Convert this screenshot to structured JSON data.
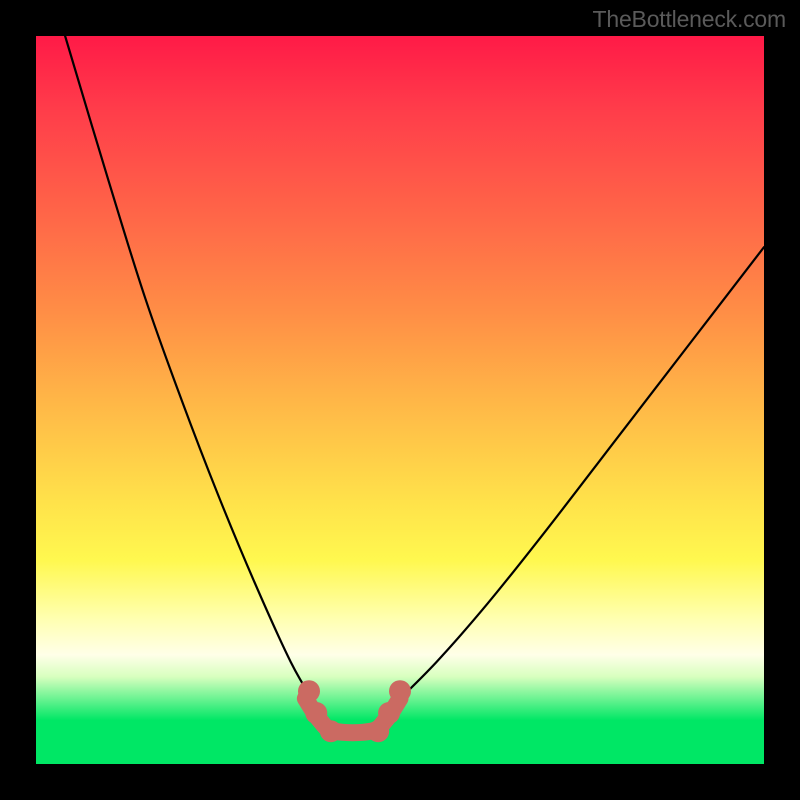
{
  "watermark": "TheBottleneck.com",
  "chart_data": {
    "type": "line",
    "title": "",
    "xlabel": "",
    "ylabel": "",
    "xlim": [
      0,
      100
    ],
    "ylim": [
      0,
      100
    ],
    "background_gradient": {
      "direction": "top_to_bottom",
      "stops": [
        {
          "pos": 0,
          "color": "#ff1a47"
        },
        {
          "pos": 10,
          "color": "#ff3c4a"
        },
        {
          "pos": 25,
          "color": "#ff6748"
        },
        {
          "pos": 38,
          "color": "#ff8e46"
        },
        {
          "pos": 50,
          "color": "#ffb647"
        },
        {
          "pos": 64,
          "color": "#ffe24a"
        },
        {
          "pos": 72,
          "color": "#fff84f"
        },
        {
          "pos": 80,
          "color": "#ffffb0"
        },
        {
          "pos": 85,
          "color": "#ffffe8"
        },
        {
          "pos": 88,
          "color": "#d8ffbf"
        },
        {
          "pos": 94,
          "color": "#00e765"
        },
        {
          "pos": 100,
          "color": "#00e765"
        }
      ]
    },
    "series": [
      {
        "name": "left_arm",
        "stroke": "#000000",
        "x": [
          4,
          10,
          15,
          20,
          25,
          30,
          35,
          38.5
        ],
        "values": [
          100,
          80,
          64,
          50,
          37,
          25,
          14,
          8
        ]
      },
      {
        "name": "right_arm",
        "stroke": "#000000",
        "x": [
          49,
          55,
          62,
          70,
          80,
          90,
          100
        ],
        "values": [
          8,
          14,
          22,
          32,
          45,
          58,
          71
        ]
      },
      {
        "name": "floor_band",
        "stroke": "#cb6a62",
        "x": [
          37,
          39,
          41,
          46,
          48,
          50
        ],
        "values": [
          9,
          6,
          4.5,
          4.5,
          6,
          9
        ]
      }
    ],
    "floor_nodes": {
      "stroke": "#cb6a62",
      "points": [
        {
          "x": 37.5,
          "y": 10
        },
        {
          "x": 38.5,
          "y": 7
        },
        {
          "x": 40.5,
          "y": 4.5
        },
        {
          "x": 47.0,
          "y": 4.5
        },
        {
          "x": 48.5,
          "y": 7
        },
        {
          "x": 50.0,
          "y": 10
        }
      ]
    }
  }
}
